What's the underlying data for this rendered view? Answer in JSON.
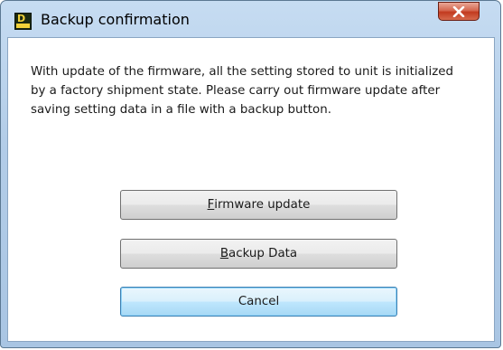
{
  "window": {
    "title": "Backup confirmation",
    "icon": "app-logo-icon",
    "close_icon": "close-icon"
  },
  "message": "With update of the firmware, all the setting stored to unit is initialized by a factory shipment state. Please carry out firmware update after saving setting data in a file with a backup button.",
  "buttons": {
    "firmware_update": {
      "mnemonic": "F",
      "rest": "irmware update"
    },
    "backup_data": {
      "mnemonic": "B",
      "rest": "ackup Data"
    },
    "cancel": {
      "label": "Cancel"
    }
  },
  "colors": {
    "titlebar": "#b3cde8",
    "close_button": "#c23a1f",
    "default_button_border": "#3c7fb1"
  }
}
